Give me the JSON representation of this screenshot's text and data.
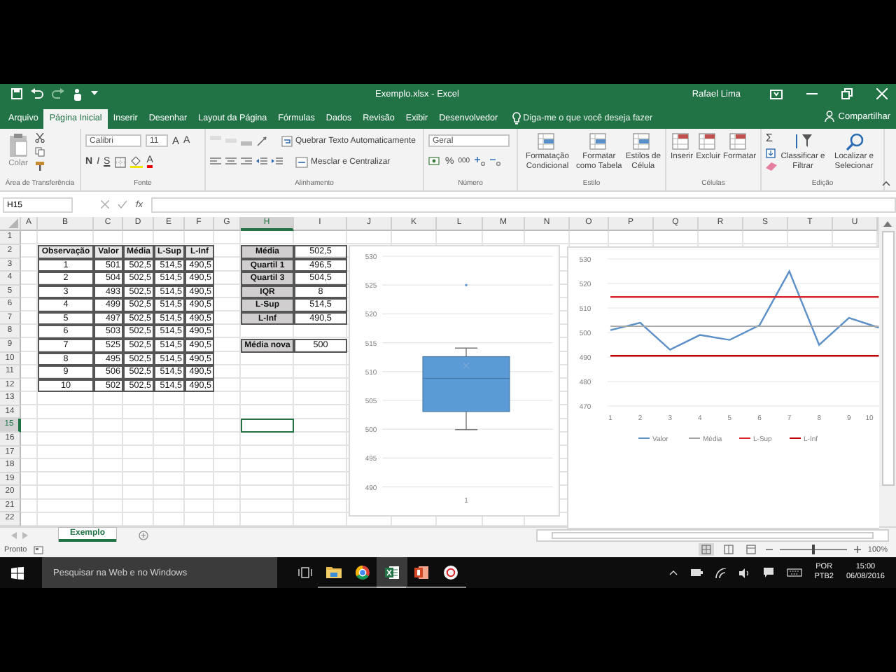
{
  "window": {
    "title": "Exemplo.xlsx - Excel",
    "user": "Rafael Lima"
  },
  "tabs": [
    {
      "label": "Arquivo",
      "selected": false
    },
    {
      "label": "Página Inicial",
      "selected": true
    },
    {
      "label": "Inserir",
      "selected": false
    },
    {
      "label": "Desenhar",
      "selected": false
    },
    {
      "label": "Layout da Página",
      "selected": false
    },
    {
      "label": "Fórmulas",
      "selected": false
    },
    {
      "label": "Dados",
      "selected": false
    },
    {
      "label": "Revisão",
      "selected": false
    },
    {
      "label": "Exibir",
      "selected": false
    },
    {
      "label": "Desenvolvedor",
      "selected": false
    }
  ],
  "tell_me": {
    "placeholder": "Diga-me o que você deseja fazer"
  },
  "share": "Compartilhar",
  "ribbon": {
    "groups": [
      {
        "kind": "clipboard",
        "label": "Área de Transferência",
        "paste": "Colar"
      },
      {
        "kind": "font",
        "label": "Fonte",
        "font": "Calibri",
        "size": "11",
        "size_buttons": [
          "A",
          "A"
        ],
        "style_buttons": [
          "N",
          "I",
          "S"
        ],
        "color_button": "A"
      },
      {
        "kind": "alignment",
        "label": "Alinhamento",
        "wrap": "Quebrar Texto Automaticamente",
        "merge": "Mesclar e Centralizar"
      },
      {
        "kind": "number",
        "label": "Número",
        "format": "Geral",
        "percent": "%",
        "thousands": "000"
      },
      {
        "kind": "buttons",
        "label": "Estilo",
        "buttons": [
          "Formatação Condicional",
          "Formatar como Tabela",
          "Estilos de Célula"
        ]
      },
      {
        "kind": "buttons",
        "label": "Células",
        "buttons": [
          "Inserir",
          "Excluir",
          "Formatar"
        ]
      },
      {
        "kind": "editing",
        "label": "Edição",
        "autosum": "Σ",
        "buttons": [
          "Classificar e Filtrar",
          "Localizar e Selecionar"
        ]
      }
    ]
  },
  "formula_bar": {
    "name_box": "H15",
    "function_label": "fx"
  },
  "sheet": {
    "columns": [
      {
        "label": "A",
        "selected": false
      },
      {
        "label": "B",
        "selected": false
      },
      {
        "label": "C",
        "selected": false
      },
      {
        "label": "D",
        "selected": false
      },
      {
        "label": "E",
        "selected": false
      },
      {
        "label": "F",
        "selected": false
      },
      {
        "label": "G",
        "selected": false
      },
      {
        "label": "H",
        "selected": true
      },
      {
        "label": "I",
        "selected": false
      },
      {
        "label": "J",
        "selected": false
      },
      {
        "label": "K",
        "selected": false
      },
      {
        "label": "L",
        "selected": false
      },
      {
        "label": "M",
        "selected": false
      },
      {
        "label": "N",
        "selected": false
      },
      {
        "label": "O",
        "selected": false
      },
      {
        "label": "P",
        "selected": false
      },
      {
        "label": "Q",
        "selected": false
      },
      {
        "label": "R",
        "selected": false
      },
      {
        "label": "S",
        "selected": false
      },
      {
        "label": "T",
        "selected": false
      },
      {
        "label": "U",
        "selected": false
      }
    ],
    "rows": [
      {
        "label": "1",
        "selected": false
      },
      {
        "label": "2",
        "selected": false
      },
      {
        "label": "3",
        "selected": false
      },
      {
        "label": "4",
        "selected": false
      },
      {
        "label": "5",
        "selected": false
      },
      {
        "label": "6",
        "selected": false
      },
      {
        "label": "7",
        "selected": false
      },
      {
        "label": "8",
        "selected": false
      },
      {
        "label": "9",
        "selected": false
      },
      {
        "label": "10",
        "selected": false
      },
      {
        "label": "11",
        "selected": false
      },
      {
        "label": "12",
        "selected": false
      },
      {
        "label": "13",
        "selected": false
      },
      {
        "label": "14",
        "selected": false
      },
      {
        "label": "15",
        "selected": true
      },
      {
        "label": "16",
        "selected": false
      },
      {
        "label": "17",
        "selected": false
      },
      {
        "label": "18",
        "selected": false
      },
      {
        "label": "19",
        "selected": false
      },
      {
        "label": "20",
        "selected": false
      },
      {
        "label": "21",
        "selected": false
      },
      {
        "label": "22",
        "selected": false
      }
    ]
  },
  "data_table": {
    "columns": [
      "Observação",
      "Valor",
      "Média",
      "L-Sup",
      "L-Inf"
    ],
    "rows": [
      [
        "1",
        "501",
        "502,5",
        "514,5",
        "490,5"
      ],
      [
        "2",
        "504",
        "502,5",
        "514,5",
        "490,5"
      ],
      [
        "3",
        "493",
        "502,5",
        "514,5",
        "490,5"
      ],
      [
        "4",
        "499",
        "502,5",
        "514,5",
        "490,5"
      ],
      [
        "5",
        "497",
        "502,5",
        "514,5",
        "490,5"
      ],
      [
        "6",
        "503",
        "502,5",
        "514,5",
        "490,5"
      ],
      [
        "7",
        "525",
        "502,5",
        "514,5",
        "490,5"
      ],
      [
        "8",
        "495",
        "502,5",
        "514,5",
        "490,5"
      ],
      [
        "9",
        "506",
        "502,5",
        "514,5",
        "490,5"
      ],
      [
        "10",
        "502",
        "502,5",
        "514,5",
        "490,5"
      ]
    ]
  },
  "summary": [
    {
      "label": "Média",
      "value": "502,5"
    },
    {
      "label": "Quartil 1",
      "value": "496,5"
    },
    {
      "label": "Quartil 3",
      "value": "504,5"
    },
    {
      "label": "IQR",
      "value": "8"
    },
    {
      "label": "L-Sup",
      "value": "514,5"
    },
    {
      "label": "L-Inf",
      "value": "490,5"
    }
  ],
  "new_mean": {
    "label": "Média nova",
    "value": "500"
  },
  "box_chart": {
    "y_axis_labels": [
      "530",
      "525",
      "520",
      "515",
      "510",
      "505",
      "500",
      "495",
      "490"
    ],
    "category": "1"
  },
  "line_chart": {
    "chart_data": {
      "type": "line",
      "grid": true,
      "legend": true,
      "categories": [
        "1",
        "2",
        "3",
        "4",
        "5",
        "6",
        "7",
        "8",
        "9",
        "10"
      ],
      "ylim": [
        470,
        530
      ],
      "yticks": [
        470,
        480,
        490,
        500,
        510,
        520,
        530
      ],
      "series": [
        {
          "name": "Valor",
          "color": "#5b8fc7",
          "values": [
            501,
            504,
            493,
            499,
            497,
            503,
            525,
            495,
            506,
            502
          ]
        },
        {
          "name": "Média",
          "color": "#a5a5a5",
          "values": [
            502.5,
            502.5,
            502.5,
            502.5,
            502.5,
            502.5,
            502.5,
            502.5,
            502.5,
            502.5
          ]
        },
        {
          "name": "L-Sup",
          "color": "#d9262c",
          "values": [
            514.5,
            514.5,
            514.5,
            514.5,
            514.5,
            514.5,
            514.5,
            514.5,
            514.5,
            514.5
          ]
        },
        {
          "name": "L-Inf",
          "color": "#c00000",
          "values": [
            490.5,
            490.5,
            490.5,
            490.5,
            490.5,
            490.5,
            490.5,
            490.5,
            490.5,
            490.5
          ]
        }
      ]
    }
  },
  "sheet_tabs": [
    {
      "label": "Exemplo",
      "selected": true
    }
  ],
  "status_bar": {
    "status": "Pronto",
    "zoom": {
      "level": 0.5,
      "reading": "100%"
    }
  },
  "taskbar": {
    "search": {
      "placeholder": "Pesquisar na Web e no Windows"
    },
    "apps": [
      {
        "selected": false
      },
      {
        "selected": false
      },
      {
        "selected": true
      },
      {
        "selected": false
      },
      {
        "selected": false
      }
    ],
    "language": "POR",
    "layout": "PTB2",
    "time": "15:00",
    "date": "06/08/2016"
  }
}
